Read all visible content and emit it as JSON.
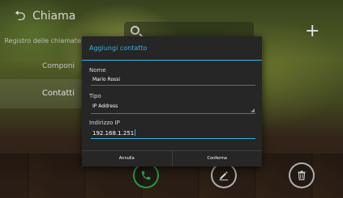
{
  "header": {
    "back_icon": "back-arrow-icon",
    "title": "Chiama",
    "add_icon": "plus-icon",
    "search_icon": "search-icon"
  },
  "sidebar": {
    "items": [
      {
        "label": "Registro delle chiamate"
      },
      {
        "label": "Componi"
      },
      {
        "label": "Contatti",
        "selected": true
      }
    ]
  },
  "bottom_bar": {
    "call_icon": "phone-icon",
    "edit_icon": "pencil-icon",
    "delete_icon": "trash-icon",
    "call_color": "#2fbe5a"
  },
  "dialog": {
    "title": "Aggiungi contatto",
    "fields": [
      {
        "label": "Nome",
        "value": "Mario Rossi"
      },
      {
        "label": "Tipo",
        "value": "IP Address"
      },
      {
        "label": "Indirizzo IP",
        "value": "192.168.1.251"
      }
    ],
    "cancel_label": "Annulla",
    "confirm_label": "Conferma",
    "accent_color": "#33b5e5"
  }
}
